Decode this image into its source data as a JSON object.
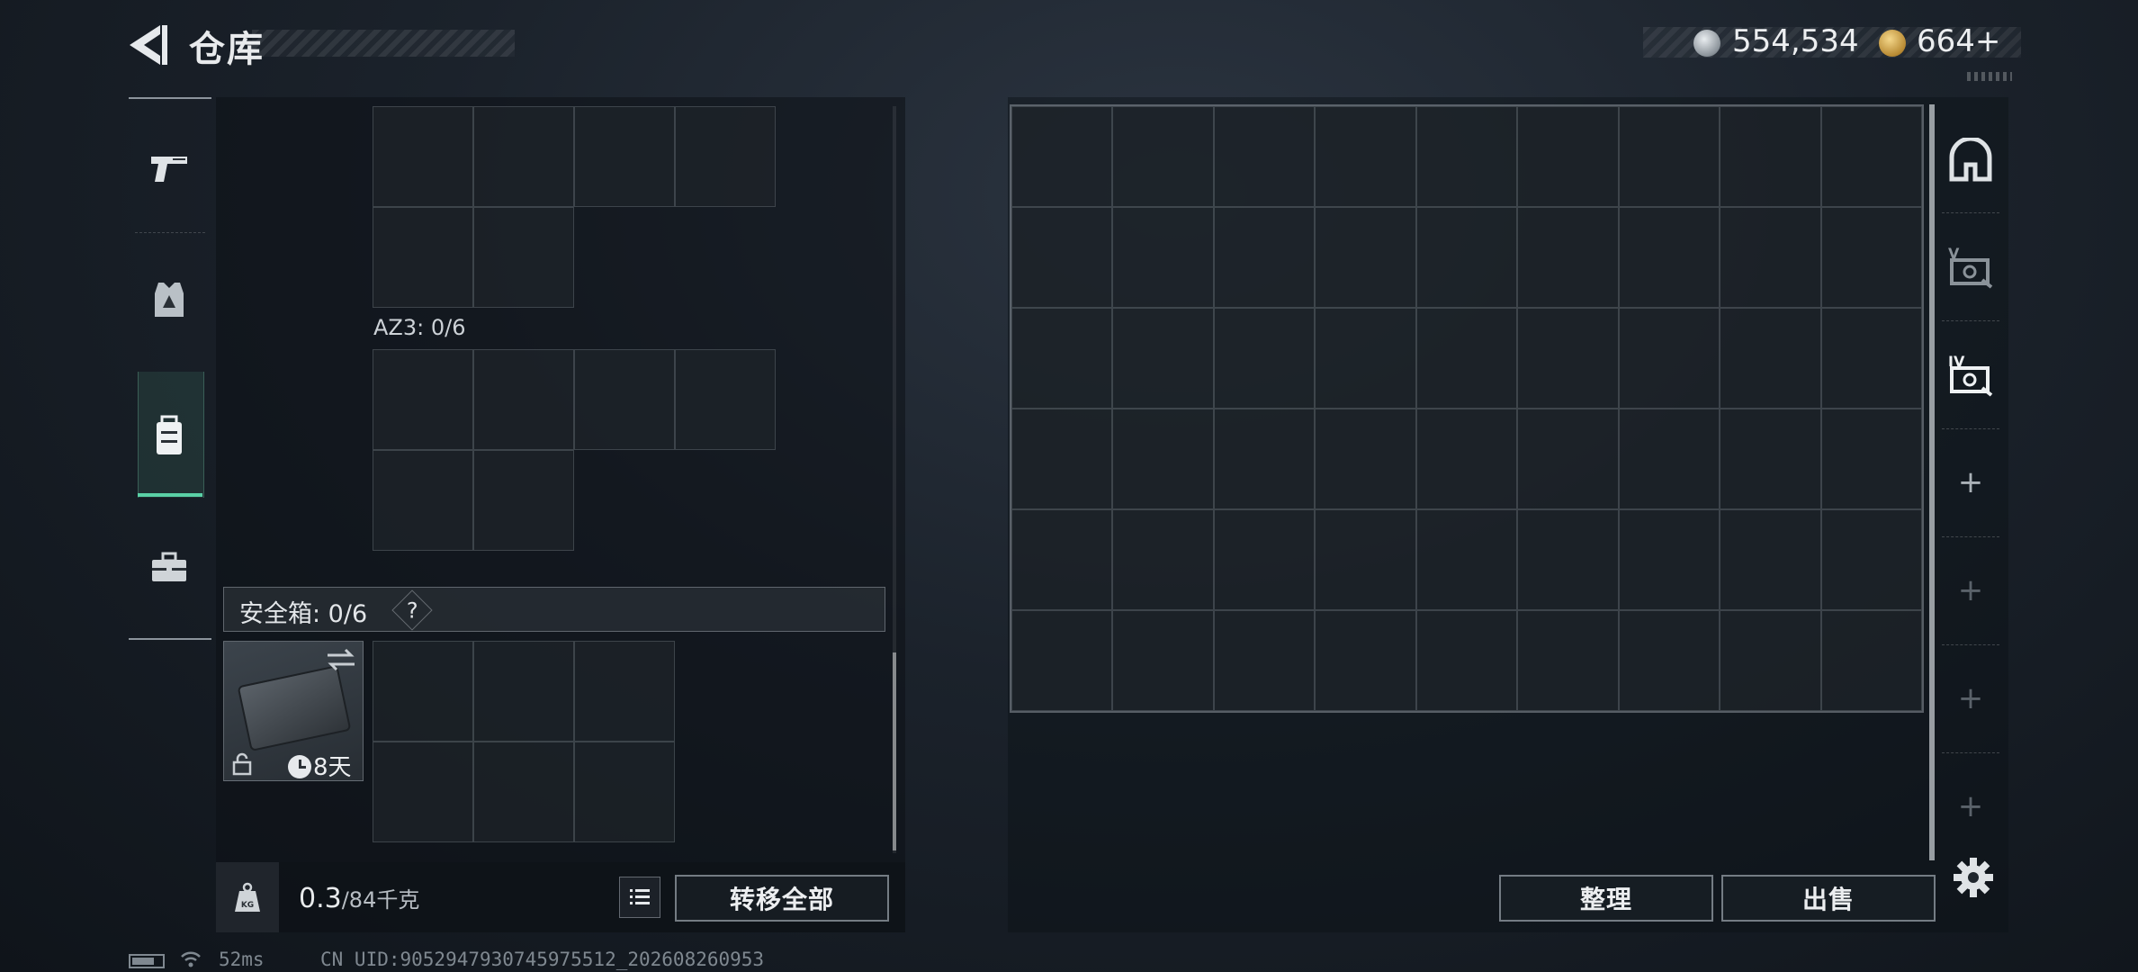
{
  "header": {
    "title": "仓库",
    "currency": [
      {
        "icon": "silver-coin-icon",
        "value": "554,534"
      },
      {
        "icon": "gold-coin-icon",
        "value": "664+"
      }
    ]
  },
  "left_nav": {
    "items": [
      {
        "name": "pistol-icon",
        "active": false
      },
      {
        "name": "vest-icon",
        "active": false
      },
      {
        "name": "backpack-icon",
        "active": true
      },
      {
        "name": "toolbox-icon",
        "active": false
      }
    ]
  },
  "inventory": {
    "az3_label": "AZ3: 0/6",
    "safebox_label": "安全箱: 0/6",
    "safebox_help": "?",
    "case_timer": "8天",
    "weight_value": "0.3",
    "weight_max": "/84千克",
    "weight_icon_text": "KG",
    "transfer_all": "转移全部"
  },
  "storage": {
    "columns": 9,
    "rows": 6,
    "tidy": "整理",
    "sell": "出售"
  },
  "right_tabs": [
    "home-vault-icon",
    "case-v-icon",
    "case-iv-icon",
    "add-tab-icon",
    "add-tab-icon",
    "add-tab-icon",
    "add-tab-icon"
  ],
  "status_bar": {
    "ping": "52ms",
    "uid": "CN UID:9052947930745975512_202608260953"
  },
  "colors": {
    "accent": "#5ad1a6",
    "panel": "#0c1116",
    "cell_border": "#8a939c"
  }
}
